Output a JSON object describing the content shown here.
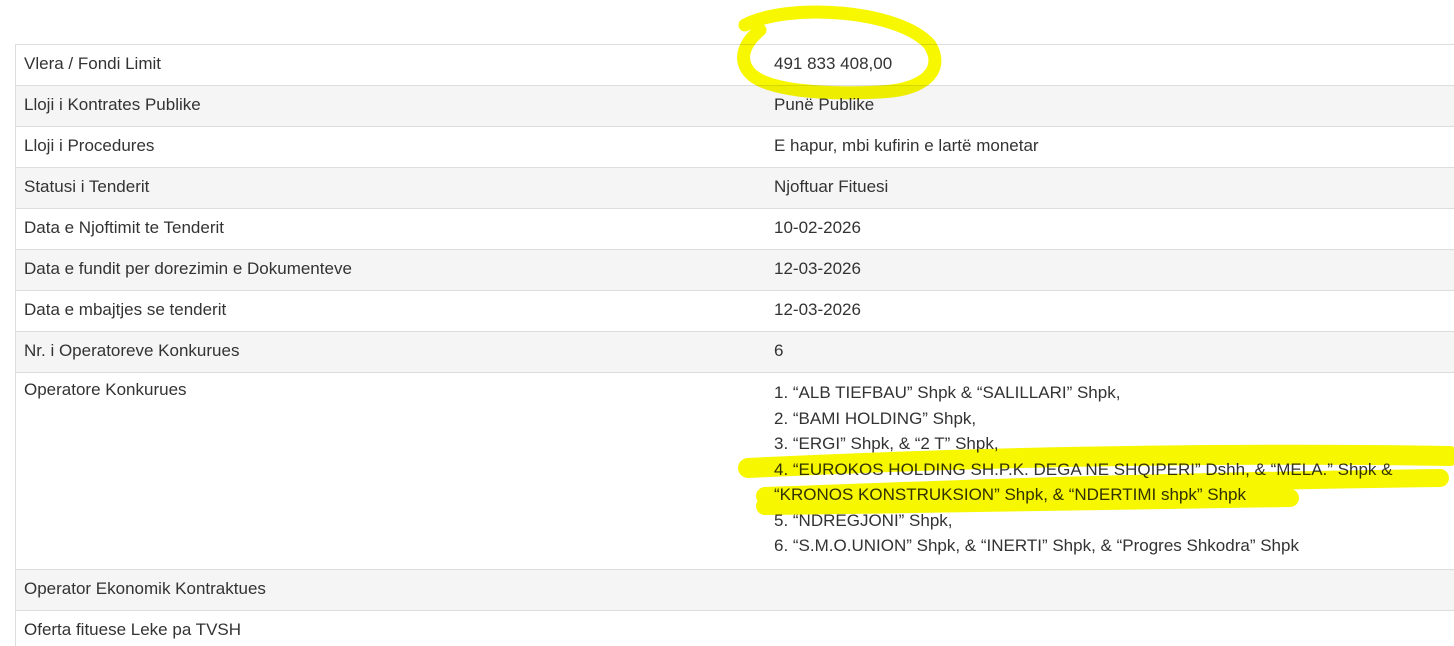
{
  "rows": [
    {
      "label": "Vlera / Fondi Limit",
      "value": "491 833 408,00"
    },
    {
      "label": "Lloji i Kontrates Publike",
      "value": "Punë Publike"
    },
    {
      "label": "Lloji i Procedures",
      "value": "E hapur, mbi kufirin e lartë monetar"
    },
    {
      "label": "Statusi i Tenderit",
      "value": "Njoftuar Fituesi"
    },
    {
      "label": "Data e Njoftimit te Tenderit",
      "value": "10-02-2026"
    },
    {
      "label": "Data e fundit per dorezimin e Dokumenteve",
      "value": "12-03-2026"
    },
    {
      "label": "Data e mbajtjes se tenderit",
      "value": "12-03-2026"
    },
    {
      "label": "Nr. i Operatoreve Konkurues",
      "value": "6"
    },
    {
      "label": "Operatore Konkurues",
      "value": ""
    },
    {
      "label": "Operator Ekonomik Kontraktues",
      "value": ""
    },
    {
      "label": "Oferta fituese Leke pa TVSH",
      "value": ""
    }
  ],
  "operators": [
    "1. “ALB TIEFBAU” Shpk & “SALILLARI” Shpk,",
    "2. “BAMI HOLDING” Shpk,",
    "3. “ERGI” Shpk, & “2 T” Shpk,",
    "4. “EUROKOS HOLDING SH.P.K. DEGA NE SHQIPERI” Dshh, & “MELA.” Shpk & “KRONOS KONSTRUKSION” Shpk, & “NDERTIMI shpk” Shpk",
    "5. “NDREGJONI” Shpk,",
    "6. “S.M.O.UNION” Shpk, & “INERTI” Shpk, & “Progres Shkodra” Shpk"
  ],
  "highlight_color": "#f7f700"
}
